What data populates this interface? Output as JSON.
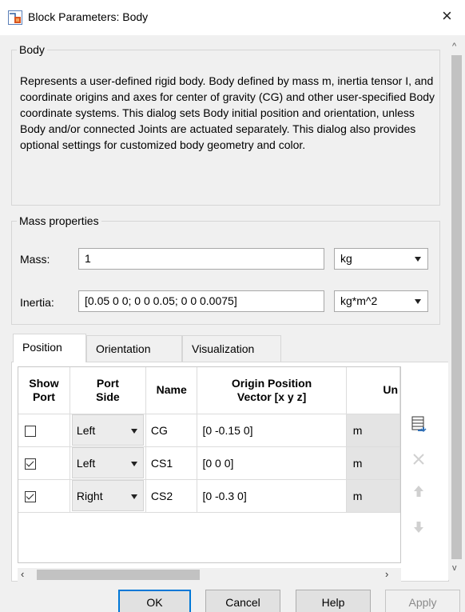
{
  "window": {
    "title": "Block Parameters: Body",
    "close_glyph": "×"
  },
  "body_group": {
    "legend": "Body",
    "description": "Represents a user-defined rigid body. Body defined by mass m, inertia tensor I, and coordinate origins and axes for center of gravity (CG) and other user-specified Body coordinate systems. This dialog sets Body initial position and orientation, unless Body and/or connected Joints are actuated separately. This dialog also provides optional settings for customized body geometry and color."
  },
  "mass_group": {
    "legend": "Mass properties",
    "mass_label": "Mass:",
    "mass_value": "1",
    "mass_unit": "kg",
    "inertia_label": "Inertia:",
    "inertia_value": "[0.05 0 0; 0 0 0.05; 0 0 0.0075]",
    "inertia_unit": "kg*m^2"
  },
  "tabs": [
    {
      "label": "Position",
      "active": true
    },
    {
      "label": "Orientation",
      "active": false
    },
    {
      "label": "Visualization",
      "active": false
    }
  ],
  "table": {
    "headers": {
      "show_port_1": "Show",
      "show_port_2": "Port",
      "port_side_1": "Port",
      "port_side_2": "Side",
      "name": "Name",
      "origin_1": "Origin Position",
      "origin_2": "Vector [x y z]",
      "units": "Un"
    },
    "rows": [
      {
        "show": false,
        "side": "Left",
        "name": "CG",
        "origin": "[0 -0.15 0]",
        "unit": "m"
      },
      {
        "show": true,
        "side": "Left",
        "name": "CS1",
        "origin": "[0 0 0]",
        "unit": "m"
      },
      {
        "show": true,
        "side": "Right",
        "name": "CS2",
        "origin": "[0 -0.3 0]",
        "unit": "m"
      }
    ]
  },
  "side_buttons": {
    "add_icon": "add-row-icon",
    "delete_icon": "delete-row-icon",
    "up_icon": "move-up-icon",
    "down_icon": "move-down-icon"
  },
  "buttons": {
    "ok": "OK",
    "cancel": "Cancel",
    "help": "Help",
    "apply": "Apply"
  },
  "colors": {
    "accent": "#0078d7",
    "panel": "#f0f0f0"
  }
}
